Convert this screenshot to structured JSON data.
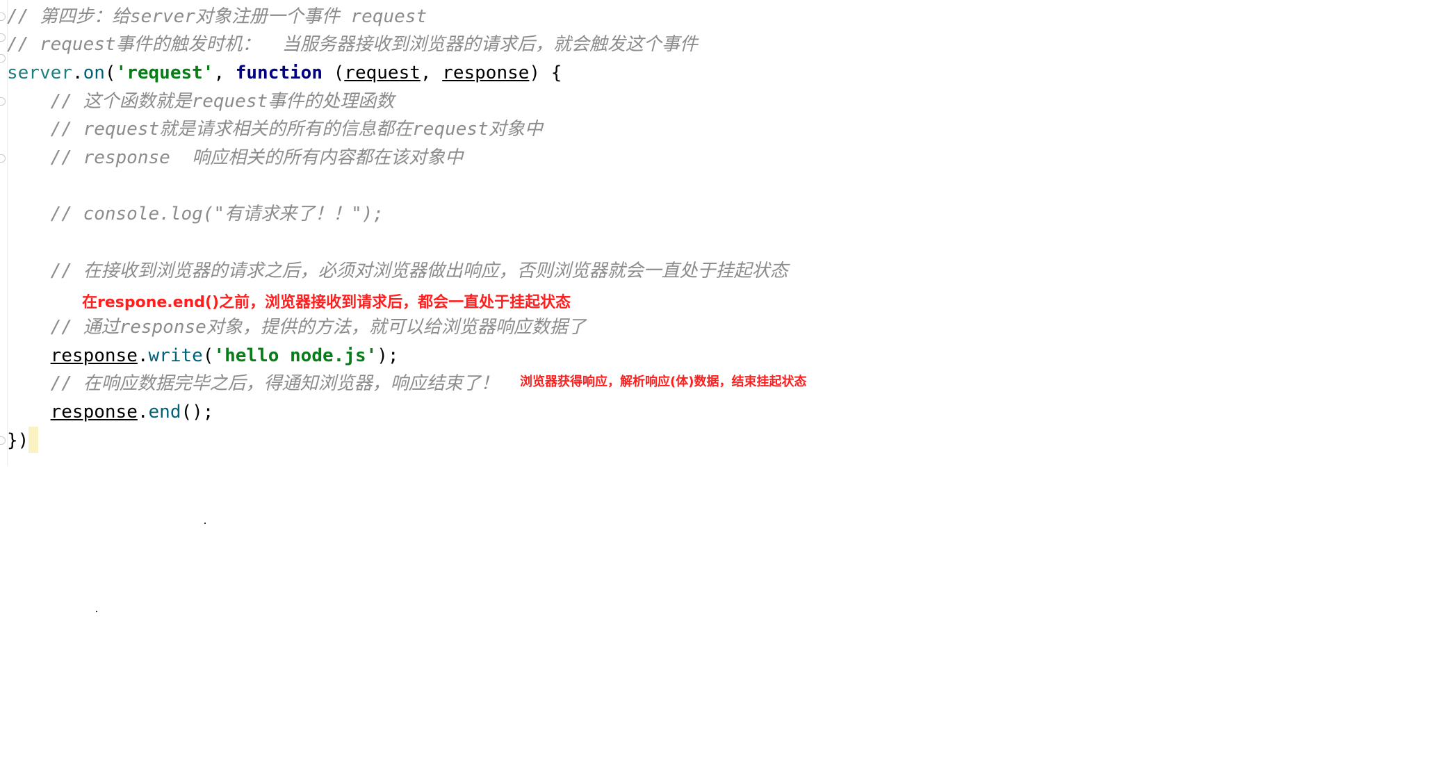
{
  "code": {
    "line1": "// 第四步：给server对象注册一个事件 request",
    "line2": "// request事件的触发时机：  当服务器接收到浏览器的请求后，就会触发这个事件",
    "line3": {
      "obj": "server",
      "dot": ".",
      "method": "on",
      "open": "(",
      "event_str": "'request'",
      "comma1": ", ",
      "keyword": "function",
      "space": " (",
      "param1": "request",
      "comma2": ", ",
      "param2": "response",
      "close": ") {"
    },
    "line4": "    // 这个函数就是request事件的处理函数",
    "line5": "    // request就是请求相关的所有的信息都在request对象中",
    "line6": "    // response  响应相关的所有内容都在该对象中",
    "line8": "    // console.log(\"有请求来了！！\");",
    "line10": "    // 在接收到浏览器的请求之后，必须对浏览器做出响应，否则浏览器就会一直处于挂起状态",
    "line11": "    // 通过response对象，提供的方法，就可以给浏览器响应数据了",
    "line12": {
      "indent": "    ",
      "obj": "response",
      "dot": ".",
      "method": "write",
      "open": "(",
      "str": "'hello node.js'",
      "close": ");"
    },
    "line13": "    // 在响应数据完毕之后，得通知浏览器，响应结束了！",
    "line14": {
      "indent": "    ",
      "obj": "response",
      "dot": ".",
      "method": "end",
      "close": "();"
    },
    "line15": "})"
  },
  "annotations": {
    "note1": "在respone.end()之前，浏览器接收到请求后，都会一直处于挂起状态",
    "note2": "浏览器获得响应，解析响应(体)数据，结束挂起状态"
  },
  "colors": {
    "comment": "#8c8c8c",
    "keyword": "#000080",
    "string": "#067d17",
    "annotation": "#ff1f1f",
    "caret_highlight": "#fbf2c4"
  }
}
